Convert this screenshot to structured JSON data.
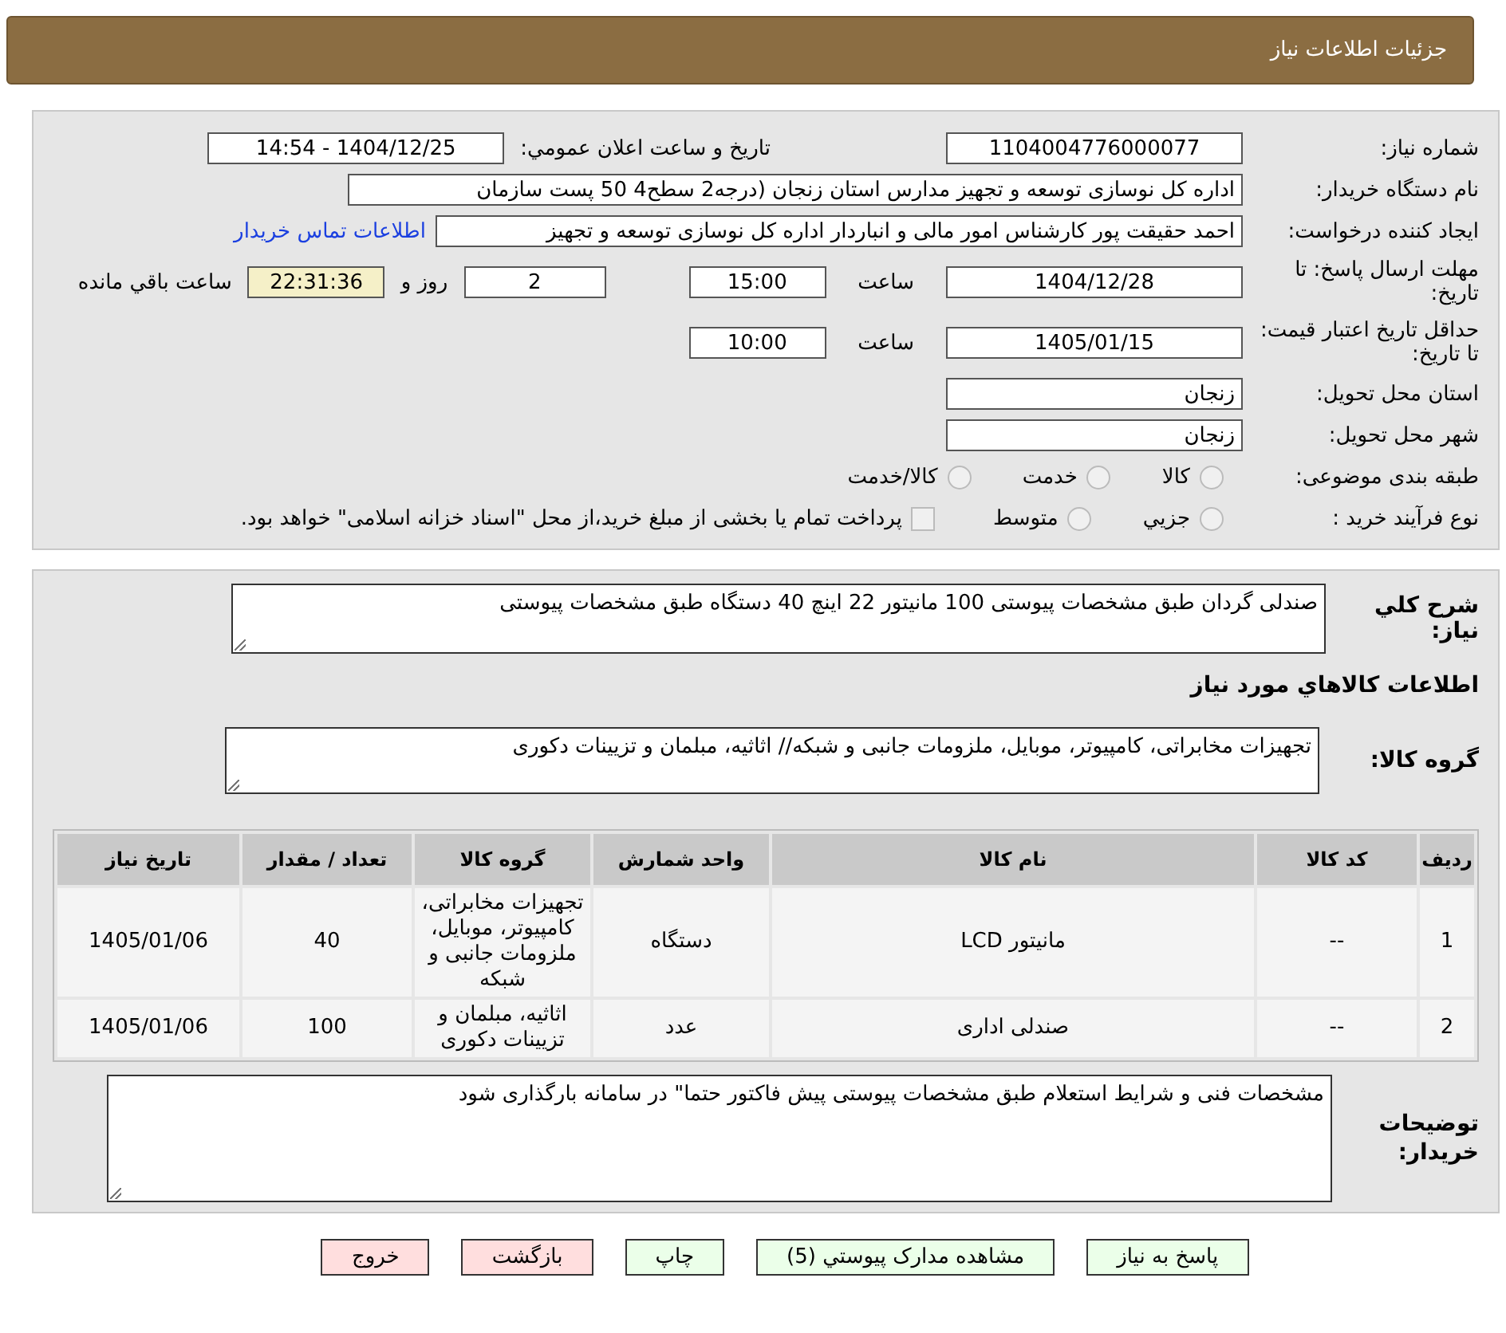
{
  "header": {
    "title": "جزئیات اطلاعات نیاز"
  },
  "need_info": {
    "need_number": {
      "label": "شماره نیاز:",
      "value": "1104004776000077"
    },
    "announce": {
      "label": "تاریخ و ساعت اعلان عمومي:",
      "value": "1404/12/25 - 14:54"
    },
    "buyer_org": {
      "label": "نام دستگاه خریدار:",
      "value": "اداره کل نوسازی   توسعه و تجهیز مدارس استان زنجان (درجه2  سطح4  50 پست سازمان"
    },
    "requester": {
      "label": "ایجاد کننده درخواست:",
      "value": "احمد حقیقت پور کارشناس امور مالی و انباردار اداره کل نوسازی   توسعه و تجهیز",
      "link": "اطلاعات تماس خریدار"
    },
    "deadline": {
      "label": "مهلت ارسال پاسخ: تا تاریخ:",
      "date": "1404/12/28",
      "time_label": "ساعت",
      "time": "15:00",
      "days": "2",
      "days_label": "روز و",
      "remaining": "22:31:36",
      "remaining_label": "ساعت باقي مانده"
    },
    "validity": {
      "label": "حداقل تاریخ اعتبار قیمت: تا تاریخ:",
      "date": "1405/01/15",
      "time_label": "ساعت",
      "time": "10:00"
    },
    "province": {
      "label": "استان محل تحویل:",
      "value": "زنجان"
    },
    "city": {
      "label": "شهر محل تحویل:",
      "value": "زنجان"
    },
    "category": {
      "label": "طبقه بندی موضوعی:",
      "options": [
        {
          "label": "کالا",
          "selected": false
        },
        {
          "label": "خدمت",
          "selected": false
        },
        {
          "label": "کالا/خدمت",
          "selected": false
        }
      ]
    },
    "process": {
      "label": "نوع فرآیند خرید :",
      "options": [
        {
          "label": "جزيي",
          "selected": false
        },
        {
          "label": "متوسط",
          "selected": false
        }
      ],
      "treasury": {
        "label": "پرداخت تمام یا بخشی از مبلغ خرید،از محل \"اسناد خزانه اسلامی\" خواهد بود.",
        "checked": false
      }
    }
  },
  "goods_info": {
    "description": {
      "label": "شرح کلي نیاز:",
      "value": "صندلی گردان طبق مشخصات  پیوستی 100 مانیتور 22 اینچ 40 دستگاه طبق مشخصات پیوستی"
    },
    "section_title": "اطلاعات کالاهاي مورد نیاز",
    "goods_group": {
      "label": "گروه کالا:",
      "value": "تجهیزات مخابراتی، کامپیوتر، موبایل، ملزومات جانبی و شبکه// اثاثیه، مبلمان و تزیینات دکوری"
    },
    "table": {
      "columns": [
        "ردیف",
        "کد کالا",
        "نام کالا",
        "واحد شمارش",
        "گروه کالا",
        "تعداد / مقدار",
        "تاریخ نیاز"
      ],
      "rows": [
        [
          "1",
          "--",
          "مانیتور LCD",
          "دستگاه",
          "تجهیزات مخابراتی، کامپیوتر، موبایل، ملزومات جانبی و شبکه",
          "40",
          "1405/01/06"
        ],
        [
          "2",
          "--",
          "صندلی اداری",
          "عدد",
          "اثاثیه، مبلمان و تزیینات دکوری",
          "100",
          "1405/01/06"
        ]
      ]
    },
    "buyer_notes": {
      "label": "توضیحات خریدار:",
      "value": "مشخصات فنی و شرایط استعلام طبق مشخصات پیوستی پیش فاکتور حتما\" در سامانه بارگذاری شود"
    }
  },
  "buttons": [
    {
      "label": "پاسخ به نیاز",
      "kind": "action"
    },
    {
      "label": "مشاهده مدارک پیوستي (5)",
      "kind": "action"
    },
    {
      "label": "چاپ",
      "kind": "action"
    },
    {
      "label": "بازگشت",
      "kind": "exit"
    },
    {
      "label": "خروج",
      "kind": "exit"
    }
  ]
}
